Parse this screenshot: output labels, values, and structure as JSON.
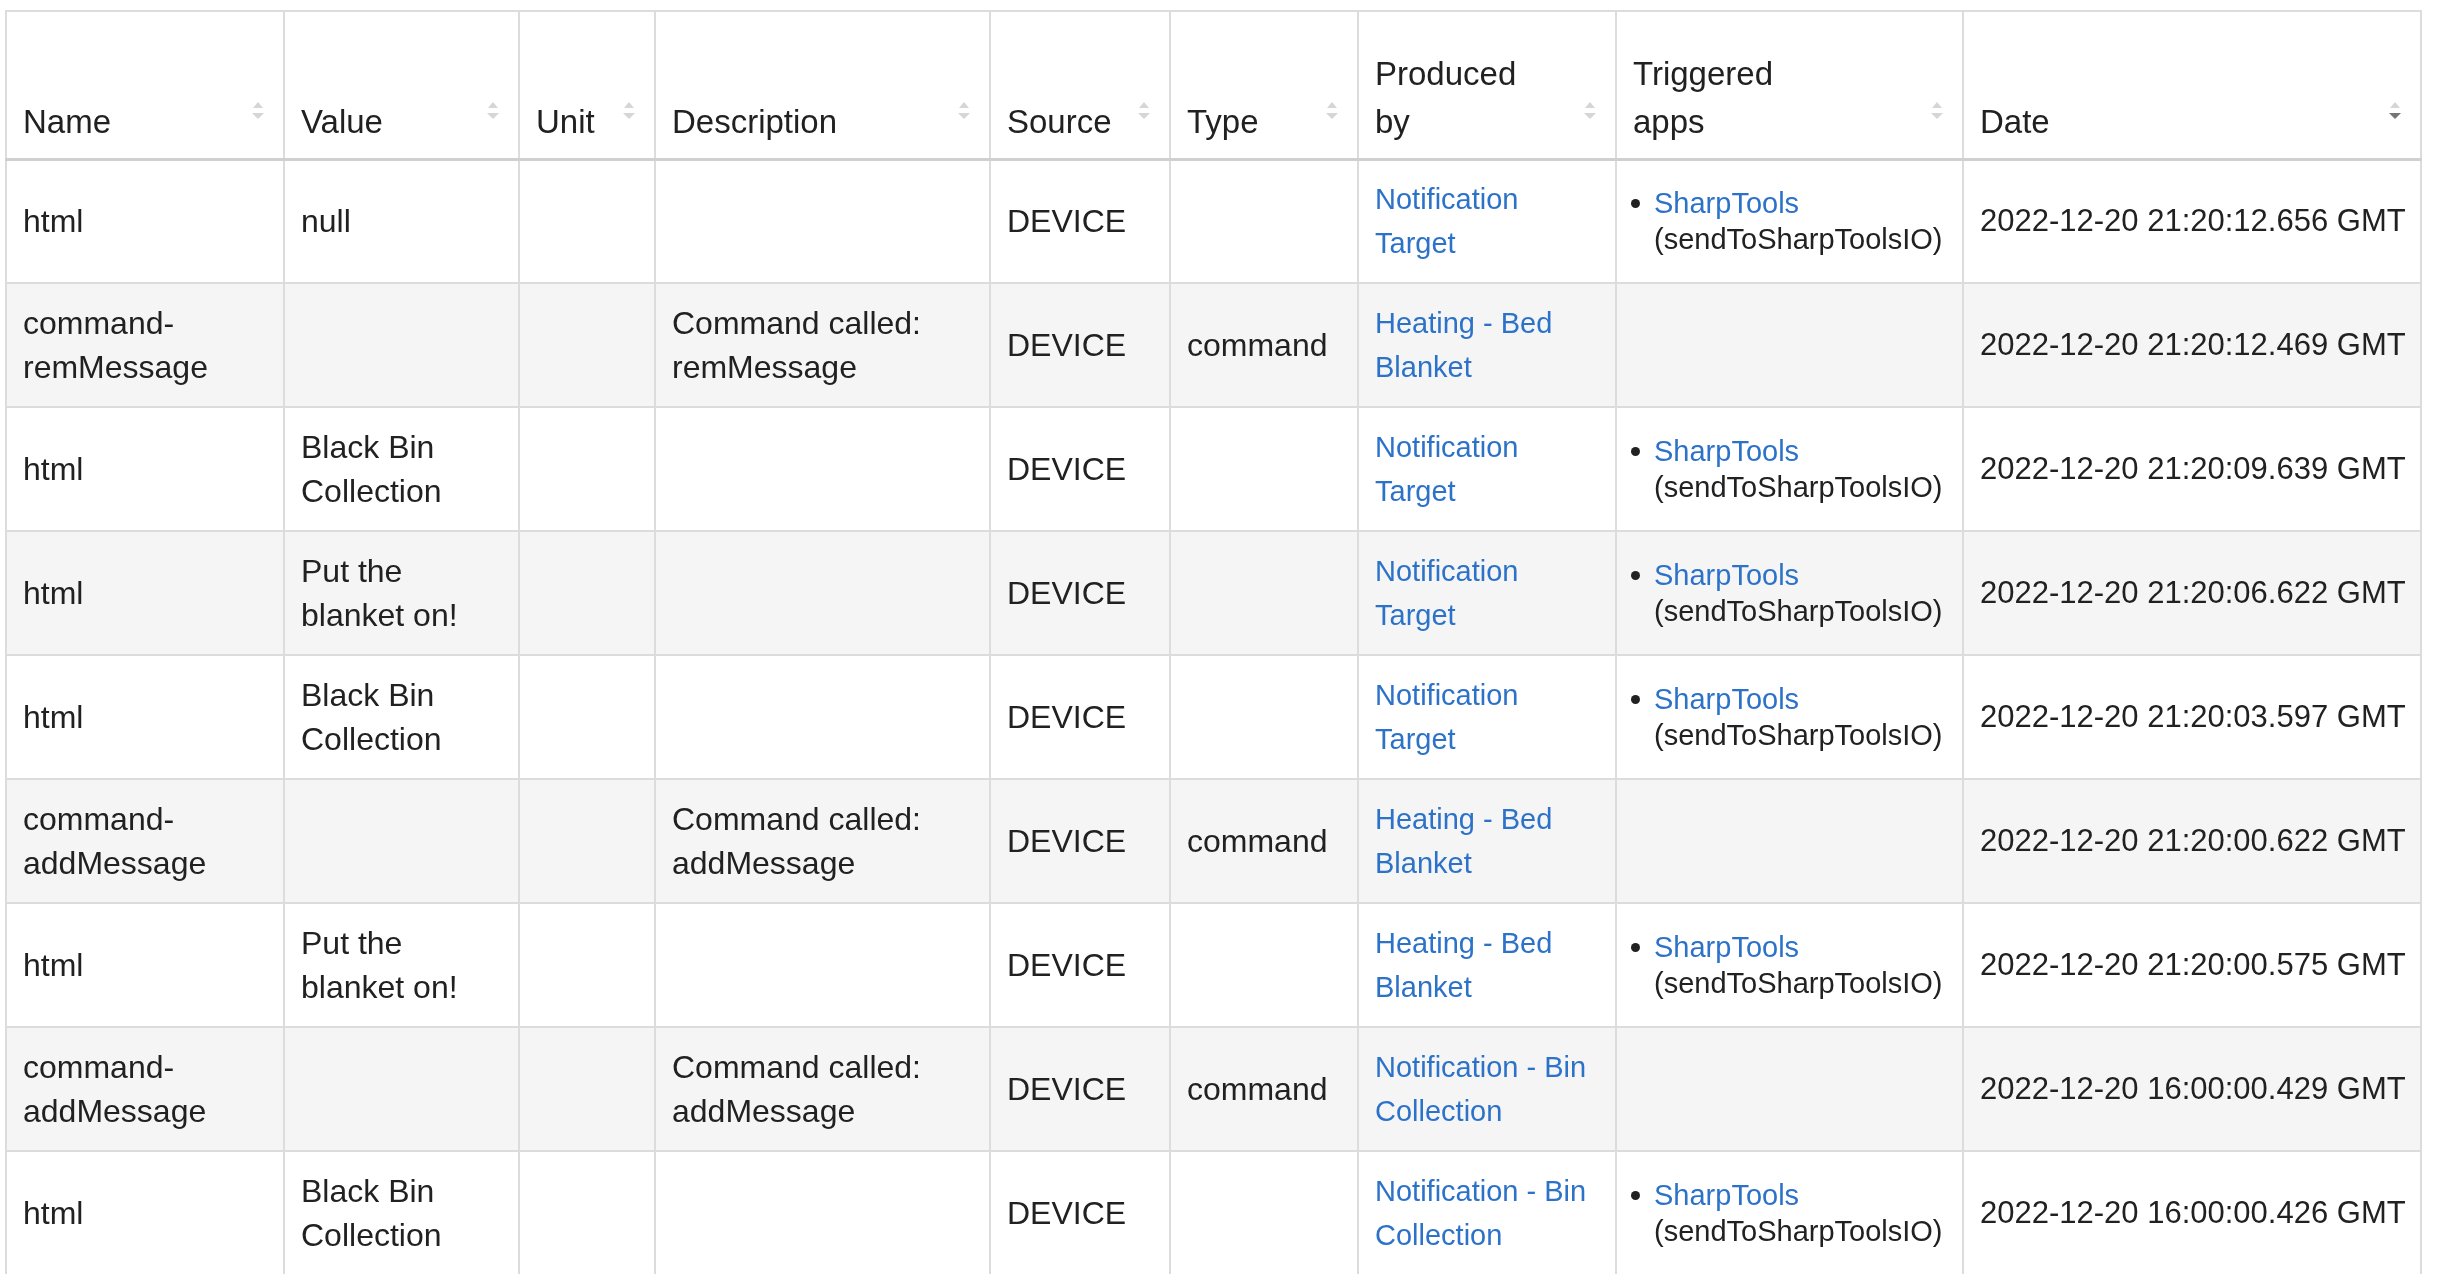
{
  "table": {
    "columns": [
      {
        "label": "Name",
        "sorted": false
      },
      {
        "label": "Value",
        "sorted": false
      },
      {
        "label": "Unit",
        "sorted": false
      },
      {
        "label": "Description",
        "sorted": false
      },
      {
        "label": "Source",
        "sorted": false
      },
      {
        "label": "Type",
        "sorted": false
      },
      {
        "label": "Produced by",
        "sorted": false
      },
      {
        "label": "Triggered apps",
        "sorted": false
      },
      {
        "label": "Date",
        "sorted": true
      }
    ],
    "rows": [
      {
        "name": "html",
        "value": "null",
        "unit": "",
        "description": "",
        "source": "DEVICE",
        "type": "",
        "produced_by": "Notification Target",
        "triggered_apps": [
          {
            "app": "SharpTools",
            "method": "(sendToSharpToolsIO)"
          }
        ],
        "date": "2022-12-20 21:20:12.656 GMT"
      },
      {
        "name": "command-remMessage",
        "value": "",
        "unit": "",
        "description": "Command called: remMessage",
        "source": "DEVICE",
        "type": "command",
        "produced_by": "Heating - Bed Blanket",
        "triggered_apps": [],
        "date": "2022-12-20 21:20:12.469 GMT"
      },
      {
        "name": "html",
        "value": "Black Bin Collection",
        "unit": "",
        "description": "",
        "source": "DEVICE",
        "type": "",
        "produced_by": "Notification Target",
        "triggered_apps": [
          {
            "app": "SharpTools",
            "method": "(sendToSharpToolsIO)"
          }
        ],
        "date": "2022-12-20 21:20:09.639 GMT"
      },
      {
        "name": "html",
        "value": "Put the blanket on!",
        "unit": "",
        "description": "",
        "source": "DEVICE",
        "type": "",
        "produced_by": "Notification Target",
        "triggered_apps": [
          {
            "app": "SharpTools",
            "method": "(sendToSharpToolsIO)"
          }
        ],
        "date": "2022-12-20 21:20:06.622 GMT"
      },
      {
        "name": "html",
        "value": "Black Bin Collection",
        "unit": "",
        "description": "",
        "source": "DEVICE",
        "type": "",
        "produced_by": "Notification Target",
        "triggered_apps": [
          {
            "app": "SharpTools",
            "method": "(sendToSharpToolsIO)"
          }
        ],
        "date": "2022-12-20 21:20:03.597 GMT"
      },
      {
        "name": "command-addMessage",
        "value": "",
        "unit": "",
        "description": "Command called: addMessage",
        "source": "DEVICE",
        "type": "command",
        "produced_by": "Heating - Bed Blanket",
        "triggered_apps": [],
        "date": "2022-12-20 21:20:00.622 GMT"
      },
      {
        "name": "html",
        "value": "Put the blanket on!",
        "unit": "",
        "description": "",
        "source": "DEVICE",
        "type": "",
        "produced_by": "Heating - Bed Blanket",
        "triggered_apps": [
          {
            "app": "SharpTools",
            "method": "(sendToSharpToolsIO)"
          }
        ],
        "date": "2022-12-20 21:20:00.575 GMT"
      },
      {
        "name": "command-addMessage",
        "value": "",
        "unit": "",
        "description": "Command called: addMessage",
        "source": "DEVICE",
        "type": "command",
        "produced_by": "Notification - Bin Collection",
        "triggered_apps": [],
        "date": "2022-12-20 16:00:00.429 GMT"
      },
      {
        "name": "html",
        "value": "Black Bin Collection",
        "unit": "",
        "description": "",
        "source": "DEVICE",
        "type": "",
        "produced_by": "Notification - Bin Collection",
        "triggered_apps": [
          {
            "app": "SharpTools",
            "method": "(sendToSharpToolsIO)"
          }
        ],
        "date": "2022-12-20 16:00:00.426 GMT"
      }
    ]
  }
}
